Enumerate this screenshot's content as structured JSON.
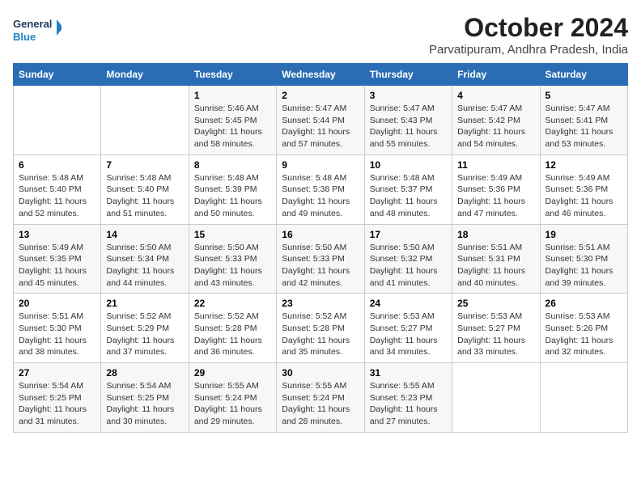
{
  "header": {
    "logo_general": "General",
    "logo_blue": "Blue",
    "title": "October 2024",
    "subtitle": "Parvatipuram, Andhra Pradesh, India"
  },
  "columns": [
    "Sunday",
    "Monday",
    "Tuesday",
    "Wednesday",
    "Thursday",
    "Friday",
    "Saturday"
  ],
  "weeks": [
    [
      {
        "day": "",
        "info": ""
      },
      {
        "day": "",
        "info": ""
      },
      {
        "day": "1",
        "info": "Sunrise: 5:46 AM\nSunset: 5:45 PM\nDaylight: 11 hours\nand 58 minutes."
      },
      {
        "day": "2",
        "info": "Sunrise: 5:47 AM\nSunset: 5:44 PM\nDaylight: 11 hours\nand 57 minutes."
      },
      {
        "day": "3",
        "info": "Sunrise: 5:47 AM\nSunset: 5:43 PM\nDaylight: 11 hours\nand 55 minutes."
      },
      {
        "day": "4",
        "info": "Sunrise: 5:47 AM\nSunset: 5:42 PM\nDaylight: 11 hours\nand 54 minutes."
      },
      {
        "day": "5",
        "info": "Sunrise: 5:47 AM\nSunset: 5:41 PM\nDaylight: 11 hours\nand 53 minutes."
      }
    ],
    [
      {
        "day": "6",
        "info": "Sunrise: 5:48 AM\nSunset: 5:40 PM\nDaylight: 11 hours\nand 52 minutes."
      },
      {
        "day": "7",
        "info": "Sunrise: 5:48 AM\nSunset: 5:40 PM\nDaylight: 11 hours\nand 51 minutes."
      },
      {
        "day": "8",
        "info": "Sunrise: 5:48 AM\nSunset: 5:39 PM\nDaylight: 11 hours\nand 50 minutes."
      },
      {
        "day": "9",
        "info": "Sunrise: 5:48 AM\nSunset: 5:38 PM\nDaylight: 11 hours\nand 49 minutes."
      },
      {
        "day": "10",
        "info": "Sunrise: 5:48 AM\nSunset: 5:37 PM\nDaylight: 11 hours\nand 48 minutes."
      },
      {
        "day": "11",
        "info": "Sunrise: 5:49 AM\nSunset: 5:36 PM\nDaylight: 11 hours\nand 47 minutes."
      },
      {
        "day": "12",
        "info": "Sunrise: 5:49 AM\nSunset: 5:36 PM\nDaylight: 11 hours\nand 46 minutes."
      }
    ],
    [
      {
        "day": "13",
        "info": "Sunrise: 5:49 AM\nSunset: 5:35 PM\nDaylight: 11 hours\nand 45 minutes."
      },
      {
        "day": "14",
        "info": "Sunrise: 5:50 AM\nSunset: 5:34 PM\nDaylight: 11 hours\nand 44 minutes."
      },
      {
        "day": "15",
        "info": "Sunrise: 5:50 AM\nSunset: 5:33 PM\nDaylight: 11 hours\nand 43 minutes."
      },
      {
        "day": "16",
        "info": "Sunrise: 5:50 AM\nSunset: 5:33 PM\nDaylight: 11 hours\nand 42 minutes."
      },
      {
        "day": "17",
        "info": "Sunrise: 5:50 AM\nSunset: 5:32 PM\nDaylight: 11 hours\nand 41 minutes."
      },
      {
        "day": "18",
        "info": "Sunrise: 5:51 AM\nSunset: 5:31 PM\nDaylight: 11 hours\nand 40 minutes."
      },
      {
        "day": "19",
        "info": "Sunrise: 5:51 AM\nSunset: 5:30 PM\nDaylight: 11 hours\nand 39 minutes."
      }
    ],
    [
      {
        "day": "20",
        "info": "Sunrise: 5:51 AM\nSunset: 5:30 PM\nDaylight: 11 hours\nand 38 minutes."
      },
      {
        "day": "21",
        "info": "Sunrise: 5:52 AM\nSunset: 5:29 PM\nDaylight: 11 hours\nand 37 minutes."
      },
      {
        "day": "22",
        "info": "Sunrise: 5:52 AM\nSunset: 5:28 PM\nDaylight: 11 hours\nand 36 minutes."
      },
      {
        "day": "23",
        "info": "Sunrise: 5:52 AM\nSunset: 5:28 PM\nDaylight: 11 hours\nand 35 minutes."
      },
      {
        "day": "24",
        "info": "Sunrise: 5:53 AM\nSunset: 5:27 PM\nDaylight: 11 hours\nand 34 minutes."
      },
      {
        "day": "25",
        "info": "Sunrise: 5:53 AM\nSunset: 5:27 PM\nDaylight: 11 hours\nand 33 minutes."
      },
      {
        "day": "26",
        "info": "Sunrise: 5:53 AM\nSunset: 5:26 PM\nDaylight: 11 hours\nand 32 minutes."
      }
    ],
    [
      {
        "day": "27",
        "info": "Sunrise: 5:54 AM\nSunset: 5:25 PM\nDaylight: 11 hours\nand 31 minutes."
      },
      {
        "day": "28",
        "info": "Sunrise: 5:54 AM\nSunset: 5:25 PM\nDaylight: 11 hours\nand 30 minutes."
      },
      {
        "day": "29",
        "info": "Sunrise: 5:55 AM\nSunset: 5:24 PM\nDaylight: 11 hours\nand 29 minutes."
      },
      {
        "day": "30",
        "info": "Sunrise: 5:55 AM\nSunset: 5:24 PM\nDaylight: 11 hours\nand 28 minutes."
      },
      {
        "day": "31",
        "info": "Sunrise: 5:55 AM\nSunset: 5:23 PM\nDaylight: 11 hours\nand 27 minutes."
      },
      {
        "day": "",
        "info": ""
      },
      {
        "day": "",
        "info": ""
      }
    ]
  ]
}
